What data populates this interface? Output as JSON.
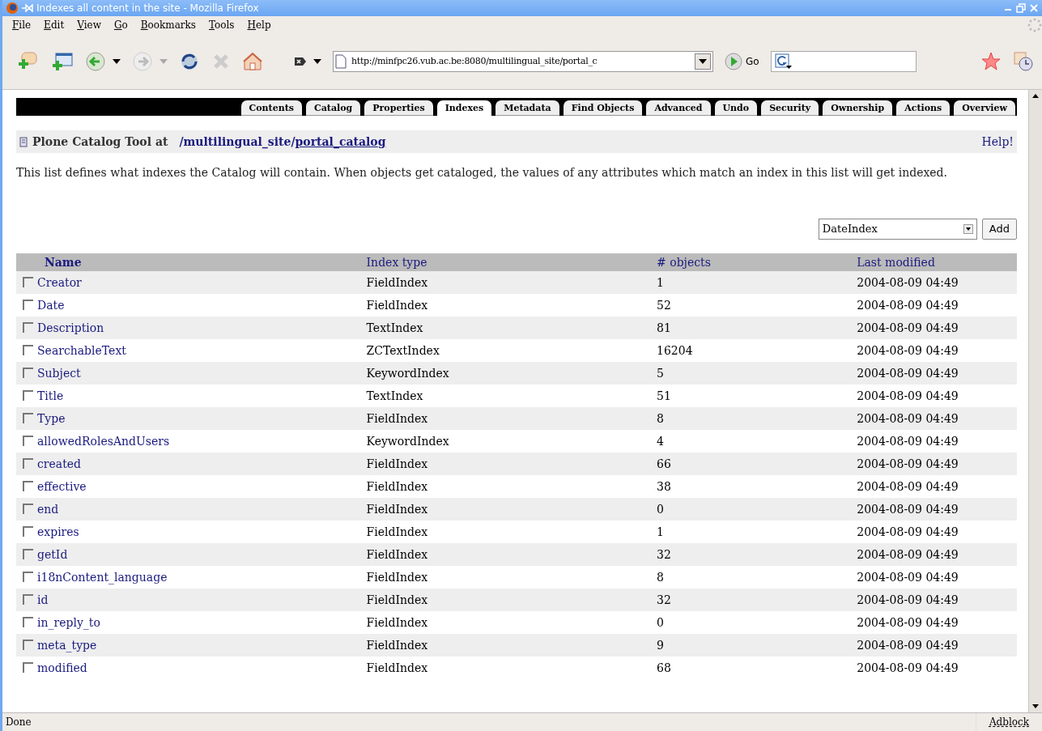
{
  "window": {
    "title": "Indexes all content in the site - Mozilla Firefox"
  },
  "menu": [
    "File",
    "Edit",
    "View",
    "Go",
    "Bookmarks",
    "Tools",
    "Help"
  ],
  "toolbar": {
    "url": "http://minfpc26.vub.ac.be:8080/multilingual_site/portal_c",
    "go": "Go"
  },
  "tabs": [
    {
      "label": "Contents",
      "selected": false
    },
    {
      "label": "Catalog",
      "selected": false
    },
    {
      "label": "Properties",
      "selected": false
    },
    {
      "label": "Indexes",
      "selected": true
    },
    {
      "label": "Metadata",
      "selected": false
    },
    {
      "label": "Find Objects",
      "selected": false
    },
    {
      "label": "Advanced",
      "selected": false
    },
    {
      "label": "Undo",
      "selected": false
    },
    {
      "label": "Security",
      "selected": false
    },
    {
      "label": "Ownership",
      "selected": false
    },
    {
      "label": "Actions",
      "selected": false
    },
    {
      "label": "Overview",
      "selected": false
    }
  ],
  "heading": {
    "title": "Plone Catalog Tool at",
    "path": "/multilingual_site/",
    "object": "portal_catalog",
    "help": "Help!"
  },
  "description": "This list defines what indexes the Catalog will contain. When objects get cataloged, the values of any attributes which match an index in this list will get indexed.",
  "add_form": {
    "index_type": "DateIndex",
    "button": "Add"
  },
  "table": {
    "columns": [
      "Name",
      "Index type",
      "# objects",
      "Last modified"
    ],
    "rows": [
      {
        "name": "Creator",
        "type": "FieldIndex",
        "objects": "1",
        "modified": "2004-08-09 04:49",
        "checked": false
      },
      {
        "name": "Date",
        "type": "FieldIndex",
        "objects": "52",
        "modified": "2004-08-09 04:49",
        "checked": false
      },
      {
        "name": "Description",
        "type": "TextIndex",
        "objects": "81",
        "modified": "2004-08-09 04:49",
        "checked": false
      },
      {
        "name": "SearchableText",
        "type": "ZCTextIndex",
        "objects": "16204",
        "modified": "2004-08-09 04:49",
        "checked": false
      },
      {
        "name": "Subject",
        "type": "KeywordIndex",
        "objects": "5",
        "modified": "2004-08-09 04:49",
        "checked": false
      },
      {
        "name": "Title",
        "type": "TextIndex",
        "objects": "51",
        "modified": "2004-08-09 04:49",
        "checked": false
      },
      {
        "name": "Type",
        "type": "FieldIndex",
        "objects": "8",
        "modified": "2004-08-09 04:49",
        "checked": false
      },
      {
        "name": "allowedRolesAndUsers",
        "type": "KeywordIndex",
        "objects": "4",
        "modified": "2004-08-09 04:49",
        "checked": false
      },
      {
        "name": "created",
        "type": "FieldIndex",
        "objects": "66",
        "modified": "2004-08-09 04:49",
        "checked": false
      },
      {
        "name": "effective",
        "type": "FieldIndex",
        "objects": "38",
        "modified": "2004-08-09 04:49",
        "checked": false
      },
      {
        "name": "end",
        "type": "FieldIndex",
        "objects": "0",
        "modified": "2004-08-09 04:49",
        "checked": false
      },
      {
        "name": "expires",
        "type": "FieldIndex",
        "objects": "1",
        "modified": "2004-08-09 04:49",
        "checked": false
      },
      {
        "name": "getId",
        "type": "FieldIndex",
        "objects": "32",
        "modified": "2004-08-09 04:49",
        "checked": false
      },
      {
        "name": "i18nContent_language",
        "type": "FieldIndex",
        "objects": "8",
        "modified": "2004-08-09 04:49",
        "checked": false
      },
      {
        "name": "id",
        "type": "FieldIndex",
        "objects": "32",
        "modified": "2004-08-09 04:49",
        "checked": false
      },
      {
        "name": "in_reply_to",
        "type": "FieldIndex",
        "objects": "0",
        "modified": "2004-08-09 04:49",
        "checked": false
      },
      {
        "name": "meta_type",
        "type": "FieldIndex",
        "objects": "9",
        "modified": "2004-08-09 04:49",
        "checked": false
      },
      {
        "name": "modified",
        "type": "FieldIndex",
        "objects": "68",
        "modified": "2004-08-09 04:49",
        "checked": false
      }
    ]
  },
  "status_bar": {
    "text": "Done",
    "adblock": "Adblock"
  }
}
